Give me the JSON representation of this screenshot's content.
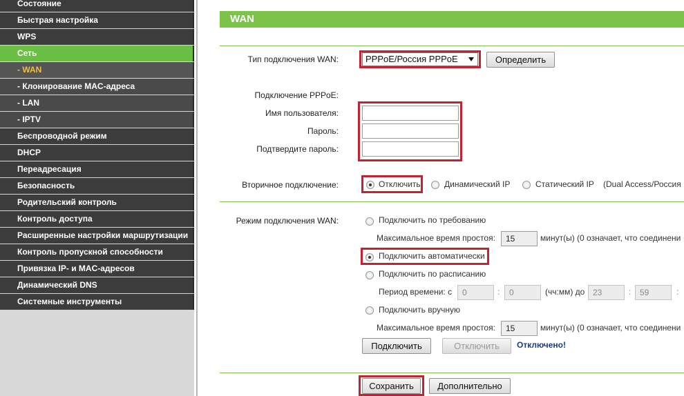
{
  "sidebar": {
    "items": [
      {
        "label": "Состояние"
      },
      {
        "label": "Быстрая настройка"
      },
      {
        "label": "WPS"
      },
      {
        "label": "Сеть"
      },
      {
        "label": "- WAN"
      },
      {
        "label": "- Клонирование MAC-адреса"
      },
      {
        "label": "- LAN"
      },
      {
        "label": "- IPTV"
      },
      {
        "label": "Беспроводной режим"
      },
      {
        "label": "DHCP"
      },
      {
        "label": "Переадресация"
      },
      {
        "label": "Безопасность"
      },
      {
        "label": "Родительский контроль"
      },
      {
        "label": "Контроль доступа"
      },
      {
        "label": "Расширенные настройки маршрутизации"
      },
      {
        "label": "Контроль пропускной способности"
      },
      {
        "label": "Привязка IP- и MAC-адресов"
      },
      {
        "label": "Динамический DNS"
      },
      {
        "label": "Системные инструменты"
      }
    ]
  },
  "header": {
    "title": "WAN"
  },
  "form": {
    "wan_type_label": "Тип подключения WAN:",
    "wan_type_value": "PPPoE/Россия PPPoE",
    "detect_button": "Определить",
    "pppoe_label": "Подключение PPPoE:",
    "username_label": "Имя пользователя:",
    "username_value": "",
    "password_label": "Пароль:",
    "password_value": "",
    "confirm_label": "Подтвердите пароль:",
    "confirm_value": "",
    "secondary_label": "Вторичное подключение:",
    "secondary_off": "Отключить",
    "secondary_dynamic": "Динамический IP",
    "secondary_static": "Статический IP",
    "secondary_note": "(Dual Access/Россия",
    "mode_label": "Режим подключения WAN:",
    "mode_on_demand": "Подключить по требованию",
    "idle_label_1": "Максимальное время простоя:",
    "idle_value_1": "15",
    "idle_note_1": "минут(ы) (0 означает, что соединени",
    "mode_auto": "Подключить автоматически",
    "mode_schedule": "Подключить по расписанию",
    "period_label": "Период времени:  с",
    "period_from_h": "0",
    "period_from_m": "0",
    "period_mid": "(чч:мм) до",
    "period_to_h": "23",
    "period_to_m": "59",
    "mode_manual": "Подключить вручную",
    "idle_label_2": "Максимальное время простоя:",
    "idle_value_2": "15",
    "idle_note_2": "минут(ы) (0 означает, что соединени",
    "connect_button": "Подключить",
    "disconnect_button": "Отключить",
    "status": "Отключено!",
    "save_button": "Сохранить",
    "advanced_button": "Дополнительно"
  },
  "colors": {
    "accent_green": "#7cc34a",
    "highlight_red": "#c8202e",
    "sidebar_dark": "#3c3c3c",
    "status_blue": "#1a3a8a"
  }
}
